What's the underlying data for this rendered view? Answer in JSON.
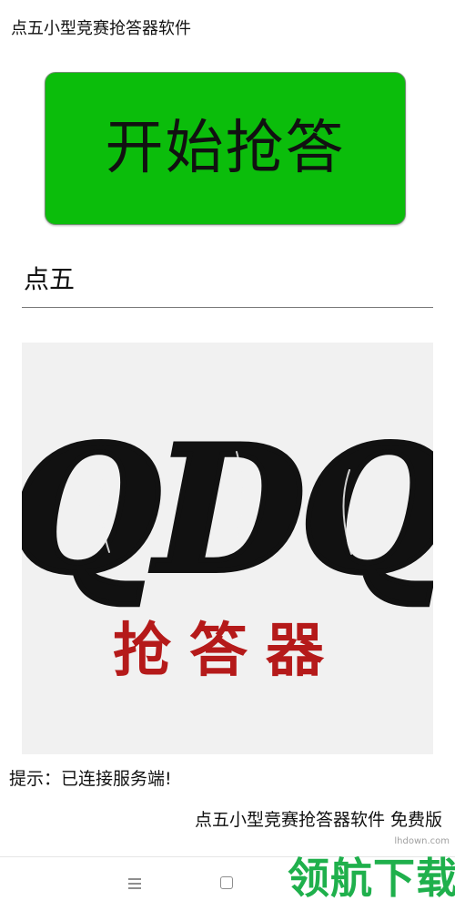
{
  "app": {
    "title": "点五小型竞赛抢答器软件"
  },
  "start_button": {
    "label": "开始抢答",
    "color": "#0bbd0b"
  },
  "name_field": {
    "value": "点五"
  },
  "logo": {
    "title": "QDQ",
    "subtitle": "抢答器",
    "title_color": "#111111",
    "subtitle_color": "#b51a1a"
  },
  "status": {
    "hint": "提示：已连接服务端!"
  },
  "footer": {
    "text": "点五小型竞赛抢答器软件 免费版"
  },
  "nav": {
    "icons": [
      "menu-icon",
      "home-icon"
    ]
  },
  "watermark": {
    "domain": "lhdown.com",
    "logo_text": "领航下载",
    "color": "#1fb04c"
  }
}
